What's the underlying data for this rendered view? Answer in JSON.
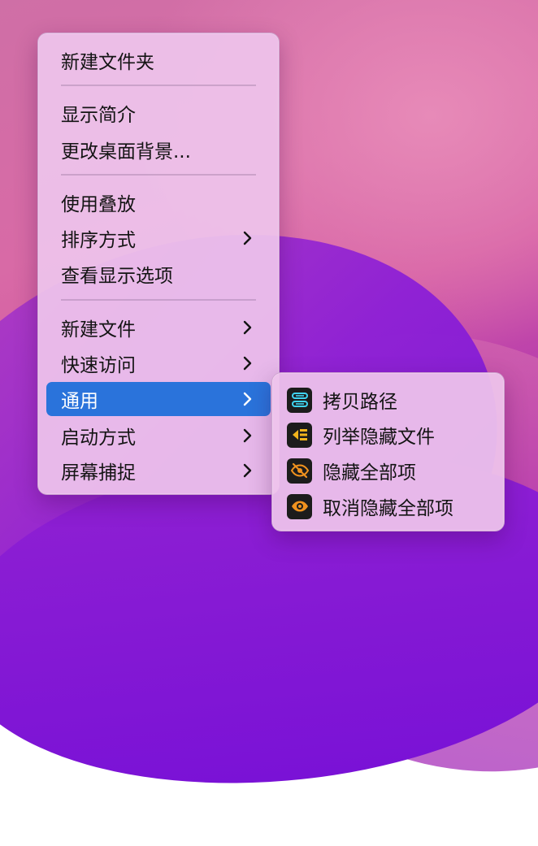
{
  "main_menu": {
    "items": [
      {
        "label": "新建文件夹"
      },
      {
        "label": "显示简介"
      },
      {
        "label": "更改桌面背景..."
      },
      {
        "label": "使用叠放"
      },
      {
        "label": "排序方式"
      },
      {
        "label": "查看显示选项"
      },
      {
        "label": "新建文件"
      },
      {
        "label": "快速访问"
      },
      {
        "label": "通用"
      },
      {
        "label": "启动方式"
      },
      {
        "label": "屏幕捕捉"
      }
    ]
  },
  "sub_menu": {
    "items": [
      {
        "label": "拷贝路径",
        "icon": "copy-path-icon"
      },
      {
        "label": "列举隐藏文件",
        "icon": "list-hidden-icon"
      },
      {
        "label": "隐藏全部项",
        "icon": "eye-slash-icon"
      },
      {
        "label": "取消隐藏全部项",
        "icon": "eye-icon"
      }
    ]
  },
  "colors": {
    "highlight": "#2a73db",
    "menu_bg": "#eec4ec",
    "icon_bg": "#1c1c1c",
    "icon_cyan": "#3fd3f0",
    "icon_yellow": "#f2b41c",
    "icon_orange": "#f0921e"
  }
}
